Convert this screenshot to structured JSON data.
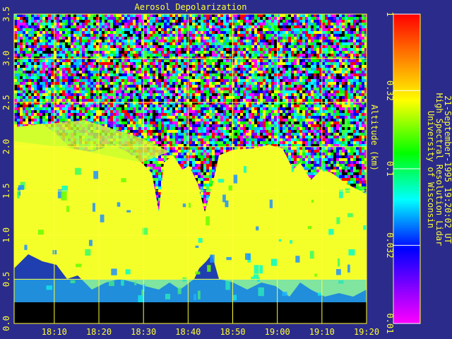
{
  "chart_data": {
    "type": "heatmap",
    "title": "Aerosol Depolarization",
    "xlabel": "",
    "ylabel": "Altitude (km)",
    "x_ticks": [
      "18:10",
      "18:20",
      "18:30",
      "18:40",
      "18:50",
      "19:00",
      "19:10",
      "19:20"
    ],
    "x_range": [
      "18:01",
      "19:20"
    ],
    "y_ticks": [
      "0.0",
      "0.5",
      "1.0",
      "1.5",
      "2.0",
      "2.5",
      "3.0",
      "3.5"
    ],
    "ylim": [
      0,
      3.5
    ],
    "grid": true,
    "color_scale": "log",
    "colorbar": {
      "ticks": [
        "0.01",
        "0.032",
        "0.1",
        "0.32",
        "1"
      ],
      "range": [
        0.01,
        1
      ],
      "colors": [
        "#ff00ff",
        "#8000ff",
        "#0000ff",
        "#00ffff",
        "#00ff00",
        "#ffff00",
        "#ff8000",
        "#ff0000"
      ]
    },
    "no_data_below_km": 0.25,
    "dominant_value": "≈0.32 (yellow) in aerosol layer below ~2 km; noisy mixed values above",
    "annotation_lines": [
      "University of Wisconsin",
      "High Spectral Resolution Lidar",
      "21-September-1995 19:20:02 UT"
    ]
  },
  "colors": {
    "background": "#2b2b8c",
    "text": "#ffff33",
    "grid": "#ffff33"
  }
}
